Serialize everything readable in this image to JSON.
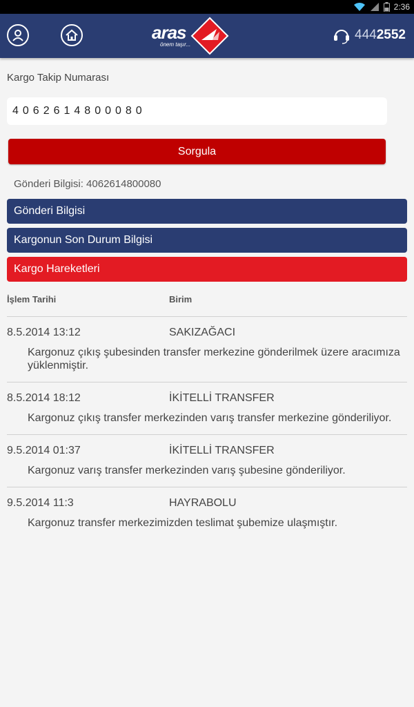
{
  "status_bar": {
    "time": "2:36"
  },
  "header": {
    "logo_text": "aras",
    "logo_tagline": "önem taşır...",
    "phone_prefix": "444",
    "phone_suffix": "2552"
  },
  "tracking": {
    "label": "Kargo Takip Numarası",
    "value": "4062614800080",
    "button_label": "Sorgula"
  },
  "shipment_info": "Gönderi Bilgisi: 4062614800080",
  "sections": [
    {
      "label": "Gönderi Bilgisi"
    },
    {
      "label": "Kargonun Son Durum Bilgisi"
    },
    {
      "label": "Kargo Hareketleri"
    }
  ],
  "movements": {
    "headers": {
      "date": "İşlem Tarihi",
      "unit": "Birim"
    },
    "rows": [
      {
        "date": "8.5.2014 13:12",
        "unit": "SAKIZAĞACI",
        "desc": "Kargonuz çıkış şubesinden transfer merkezine gönderilmek üzere aracımıza yüklenmiştir."
      },
      {
        "date": "8.5.2014 18:12",
        "unit": "İKİTELLİ TRANSFER",
        "desc": "Kargonuz çıkış transfer merkezinden varış transfer merkezine gönderiliyor."
      },
      {
        "date": "9.5.2014 01:37",
        "unit": "İKİTELLİ TRANSFER",
        "desc": "Kargonuz varış transfer merkezinden varış şubesine gönderiliyor."
      },
      {
        "date": "9.5.2014 11:3",
        "unit": "HAYRABOLU",
        "desc": "Kargonuz transfer merkezimizden teslimat şubemize ulaşmıştır."
      }
    ]
  },
  "colors": {
    "header_bg": "#2a3d72",
    "button_red": "#bf0000",
    "active_section_red": "#e31b23"
  }
}
